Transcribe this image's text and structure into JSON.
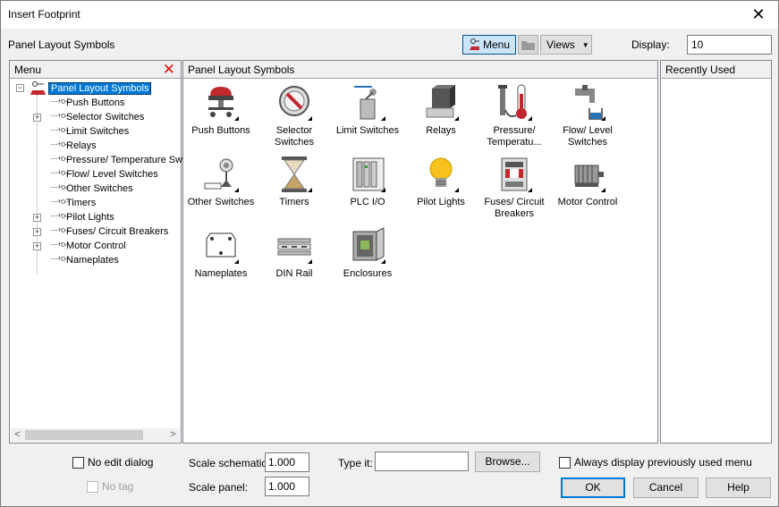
{
  "window": {
    "title": "Insert Footprint"
  },
  "header": {
    "subtitle": "Panel Layout Symbols"
  },
  "toolbar": {
    "menu_label": "Menu",
    "views_label": "Views",
    "display_label": "Display:",
    "display_value": "10"
  },
  "menu_panel": {
    "heading": "Menu",
    "root": "Panel Layout Symbols",
    "items": [
      {
        "label": "Push Buttons",
        "expandable": false
      },
      {
        "label": "Selector Switches",
        "expandable": true
      },
      {
        "label": "Limit Switches",
        "expandable": false
      },
      {
        "label": "Relays",
        "expandable": false
      },
      {
        "label": "Pressure/ Temperature Sw",
        "expandable": false
      },
      {
        "label": "Flow/ Level Switches",
        "expandable": false
      },
      {
        "label": "Other Switches",
        "expandable": false
      },
      {
        "label": "Timers",
        "expandable": false
      },
      {
        "label": "Pilot Lights",
        "expandable": true
      },
      {
        "label": "Fuses/ Circuit Breakers",
        "expandable": true
      },
      {
        "label": "Motor Control",
        "expandable": true
      },
      {
        "label": "Nameplates",
        "expandable": false
      }
    ]
  },
  "center_panel": {
    "heading": "Panel Layout Symbols",
    "symbols": [
      {
        "label": "Push Buttons",
        "icon": "push-button-icon"
      },
      {
        "label": "Selector Switches",
        "icon": "selector-switch-icon"
      },
      {
        "label": "Limit Switches",
        "icon": "limit-switch-icon"
      },
      {
        "label": "Relays",
        "icon": "relay-icon"
      },
      {
        "label": "Pressure/ Temperatu...",
        "icon": "thermometer-icon"
      },
      {
        "label": "Flow/ Level Switches",
        "icon": "faucet-icon"
      },
      {
        "label": "Other Switches",
        "icon": "other-switch-icon"
      },
      {
        "label": "Timers",
        "icon": "hourglass-icon"
      },
      {
        "label": "PLC I/O",
        "icon": "plc-icon"
      },
      {
        "label": "Pilot Lights",
        "icon": "lightbulb-icon"
      },
      {
        "label": "Fuses/ Circuit Breakers",
        "icon": "fuse-icon"
      },
      {
        "label": "Motor Control",
        "icon": "motor-icon"
      },
      {
        "label": "Nameplates",
        "icon": "nameplate-icon"
      },
      {
        "label": "DIN Rail",
        "icon": "din-rail-icon"
      },
      {
        "label": "Enclosures",
        "icon": "enclosure-icon"
      }
    ]
  },
  "recent_panel": {
    "heading": "Recently Used"
  },
  "bottom": {
    "no_edit_dialog": "No edit dialog",
    "no_tag": "No tag",
    "scale_schematic_label": "Scale schematic:",
    "scale_schematic_value": "1.000",
    "scale_panel_label": "Scale panel:",
    "scale_panel_value": "1.000",
    "type_it_label": "Type it:",
    "type_it_value": "",
    "browse_label": "Browse...",
    "always_display_label": "Always display previously used menu",
    "ok_label": "OK",
    "cancel_label": "Cancel",
    "help_label": "Help"
  }
}
